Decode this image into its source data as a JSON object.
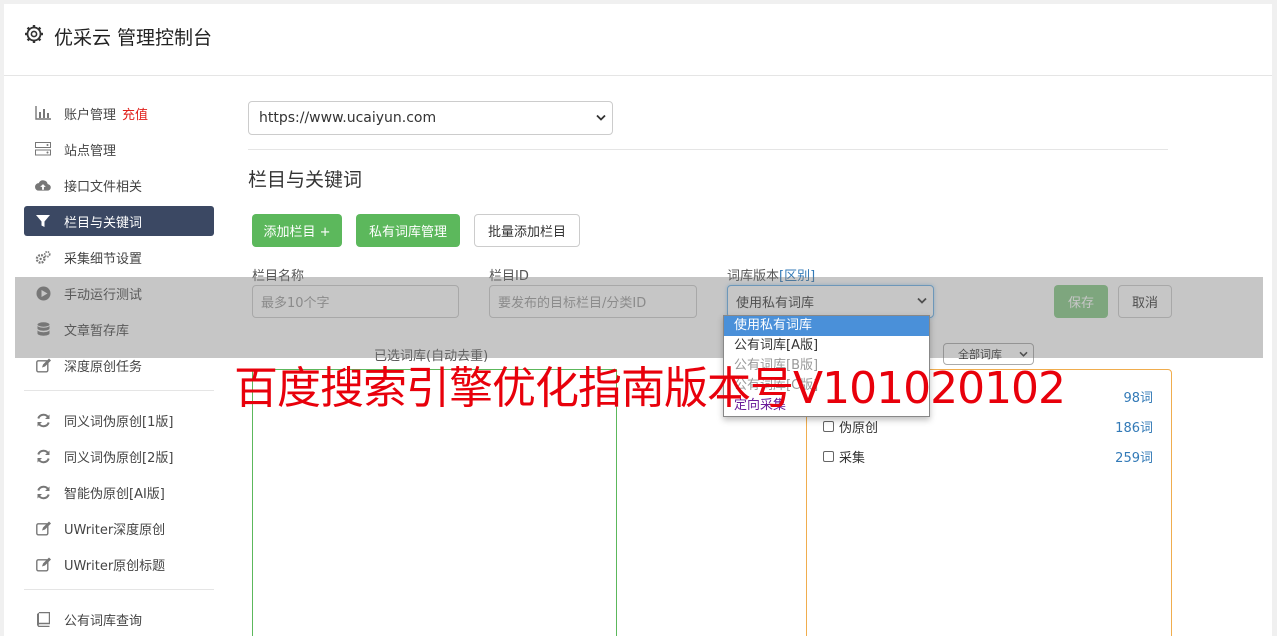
{
  "app": {
    "title": "优采云 管理控制台"
  },
  "sidebar": {
    "items": [
      {
        "label": "账户管理",
        "badge": "充值",
        "icon": "bar-chart-icon"
      },
      {
        "label": "站点管理",
        "icon": "server-icon"
      },
      {
        "label": "接口文件相关",
        "icon": "cloud-upload-icon"
      },
      {
        "label": "栏目与关键词",
        "icon": "filter-icon",
        "active": true
      },
      {
        "label": "采集细节设置",
        "icon": "gears-icon"
      },
      {
        "label": "手动运行测试",
        "icon": "play-icon"
      },
      {
        "label": "文章暂存库",
        "icon": "database-icon"
      },
      {
        "label": "深度原创任务",
        "icon": "edit-icon"
      }
    ],
    "items2": [
      {
        "label": "同义词伪原创[1版]",
        "icon": "refresh-icon"
      },
      {
        "label": "同义词伪原创[2版]",
        "icon": "refresh-icon"
      },
      {
        "label": "智能伪原创[AI版]",
        "icon": "refresh-icon"
      },
      {
        "label": "UWriter深度原创",
        "icon": "edit-icon"
      },
      {
        "label": "UWriter原创标题",
        "icon": "edit-icon"
      }
    ],
    "items3": [
      {
        "label": "公有词库查询",
        "icon": "book-icon"
      }
    ]
  },
  "main": {
    "site_select": {
      "value": "https://www.ucaiyun.com"
    },
    "section_title": "栏目与关键词",
    "buttons": {
      "add": "添加栏目 +",
      "private_lex": "私有词库管理",
      "batch_add": "批量添加栏目"
    },
    "form": {
      "name_label": "栏目名称",
      "name_placeholder": "最多10个字",
      "id_label": "栏目ID",
      "id_placeholder": "要发布的目标栏目/分类ID",
      "lex_label": "词库版本",
      "lex_link": "[区别]",
      "lex_value": "使用私有词库",
      "save": "保存",
      "cancel": "取消"
    },
    "selected_lex_label": "已选词库(自动去重)",
    "all_lex_select": "全部词库",
    "lex_list": [
      {
        "name": "",
        "count": "98词"
      },
      {
        "name": "伪原创",
        "count": "186词"
      },
      {
        "name": "采集",
        "count": "259词"
      }
    ],
    "dropdown_options": [
      "使用私有词库",
      "公有词库[A版]",
      "公有词库[B版]",
      "公有词库[C版]",
      "定向采集"
    ]
  },
  "watermark": "百度搜索引擎优化指南版本号V101020102",
  "colors": {
    "green": "#5cb85c",
    "active_nav": "#3b4863",
    "red": "#e0201b",
    "link": "#337ab7"
  }
}
